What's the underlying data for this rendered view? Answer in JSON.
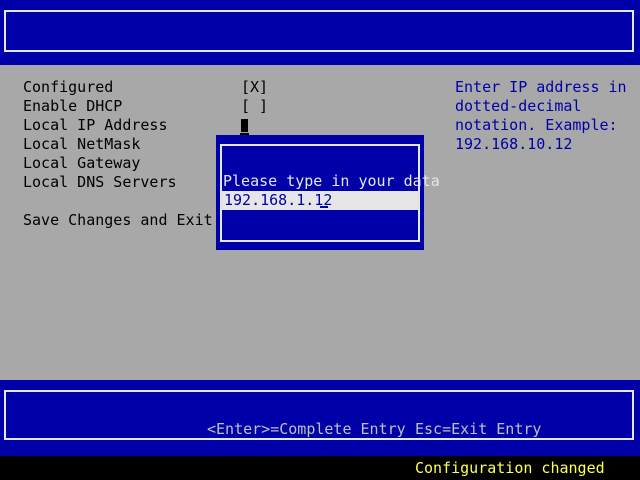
{
  "menu": {
    "items": [
      {
        "label": "Configured",
        "value": "[X]"
      },
      {
        "label": "Enable DHCP",
        "value": "[ ]"
      },
      {
        "label": "Local IP Address",
        "value": ""
      },
      {
        "label": "Local NetMask",
        "value": ""
      },
      {
        "label": "Local Gateway",
        "value": ""
      },
      {
        "label": "Local DNS Servers",
        "value": ""
      }
    ],
    "save_exit": "Save Changes and Exit"
  },
  "help": {
    "lines": [
      "Enter IP address in",
      "dotted-decimal",
      "notation. Example:",
      "192.168.10.12"
    ]
  },
  "dialog": {
    "prompt": "Please type in your data",
    "input_value": "192.168.1.12"
  },
  "footer": {
    "enter_hint": "<Enter>=Complete Entry",
    "esc_hint": "Esc=Exit Entry"
  },
  "status": {
    "text": "Configuration changed"
  },
  "colors": {
    "blue": "#0000a8",
    "grey": "#a8a8a8",
    "white": "#e6e6e6",
    "yellow": "#ffff55"
  }
}
